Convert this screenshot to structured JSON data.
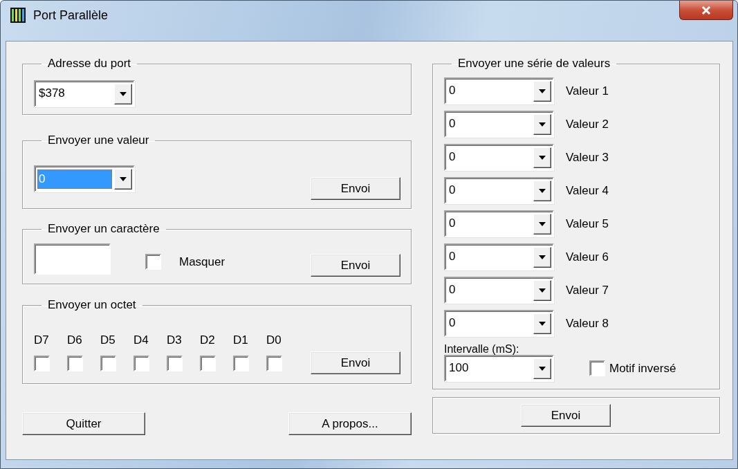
{
  "window": {
    "title": "Port Parallèle"
  },
  "port_address": {
    "title": "Adresse du port",
    "value": "$378"
  },
  "send_value": {
    "title": "Envoyer une valeur",
    "value": "0",
    "text_selected": true,
    "button": "Envoi"
  },
  "send_char": {
    "title": "Envoyer un caractère",
    "mask": {
      "label": "Masquer",
      "checked": false
    },
    "button": "Envoi"
  },
  "send_byte": {
    "title": "Envoyer un octet",
    "bits": [
      {
        "label": "D7",
        "checked": false
      },
      {
        "label": "D6",
        "checked": false
      },
      {
        "label": "D5",
        "checked": false
      },
      {
        "label": "D4",
        "checked": false
      },
      {
        "label": "D3",
        "checked": false
      },
      {
        "label": "D2",
        "checked": false
      },
      {
        "label": "D1",
        "checked": false
      },
      {
        "label": "D0",
        "checked": false
      }
    ],
    "button": "Envoi"
  },
  "buttons": [
    "Quitter",
    "A propos..."
  ],
  "series": {
    "title": "Envoyer une série de valeurs",
    "values": [
      {
        "value": "0",
        "label": "Valeur 1"
      },
      {
        "value": "0",
        "label": "Valeur 2"
      },
      {
        "value": "0",
        "label": "Valeur 3"
      },
      {
        "value": "0",
        "label": "Valeur 4"
      },
      {
        "value": "0",
        "label": "Valeur 5"
      },
      {
        "value": "0",
        "label": "Valeur 6"
      },
      {
        "value": "0",
        "label": "Valeur 7"
      },
      {
        "value": "0",
        "label": "Valeur 8"
      }
    ],
    "interval": {
      "label": "Intervalle (mS):",
      "value": "100"
    },
    "inverse": {
      "label": "Motif inversé",
      "checked": false
    }
  },
  "series_send": {
    "button": "Envoi"
  }
}
